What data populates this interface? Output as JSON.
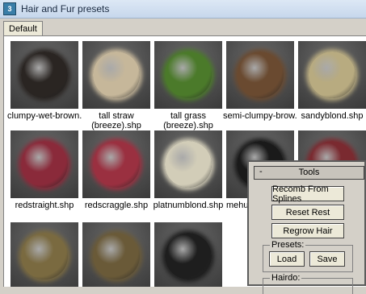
{
  "window": {
    "title": "Hair and Fur presets",
    "icon": "3ds-max-icon"
  },
  "tabs": [
    {
      "label": "Default"
    }
  ],
  "presets": [
    {
      "line1": "clumpy-wet-brown....",
      "line2": "",
      "color": "#2a2522"
    },
    {
      "line1": "tall straw",
      "line2": "(breeze).shp",
      "color": "#c6b79a"
    },
    {
      "line1": "tall grass",
      "line2": "(breeze).shp",
      "color": "#4b7a2a"
    },
    {
      "line1": "semi-clumpy-brow...",
      "line2": "",
      "color": "#6a4a30"
    },
    {
      "line1": "sandyblond.shp",
      "line2": "",
      "color": "#b8ab80"
    },
    {
      "line1": "redstraight.shp",
      "line2": "",
      "color": "#8a2a3a"
    },
    {
      "line1": "redscraggle.shp",
      "line2": "",
      "color": "#9a3040"
    },
    {
      "line1": "platnumblond.shp",
      "line2": "",
      "color": "#d2cdb8"
    },
    {
      "line1": "mehulk",
      "line2": "",
      "color": "#1a1a1a"
    },
    {
      "line1": "",
      "line2": "",
      "color": "#7a2a30"
    },
    {
      "line1": "",
      "line2": "",
      "color": "#7a6a40"
    },
    {
      "line1": "",
      "line2": "",
      "color": "#6a5a38"
    },
    {
      "line1": "",
      "line2": "",
      "color": "#1e1e1e"
    }
  ],
  "tools": {
    "title": "Tools",
    "collapse": "-",
    "recomb": "Recomb From Splines",
    "reset": "Reset Rest",
    "regrow": "Regrow Hair",
    "presets_label": "Presets:",
    "load": "Load",
    "save": "Save",
    "hairdo_label": "Hairdo:"
  }
}
